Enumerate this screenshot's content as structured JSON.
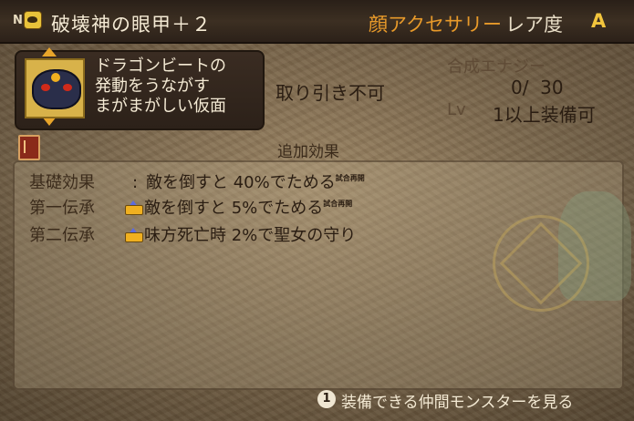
{
  "header": {
    "n_label": "N",
    "item_name": "破壊神の眼甲＋２",
    "category": "顔アクセサリー",
    "rarity_label": "レア度",
    "rarity_value": "A"
  },
  "description": {
    "lines": [
      "ドラゴンビートの",
      "発動をうながす",
      "まがまがしい仮面"
    ]
  },
  "info": {
    "trade": "取り引き不可",
    "synth_label": "合成エナジー",
    "synth_value": "0/  30",
    "lv_label": "Lv",
    "lv_value": "1以上装備可"
  },
  "effects": {
    "header": "追加効果",
    "rows": [
      {
        "label": "基礎効果",
        "separator": ":",
        "text": "敵を倒すと 40%でためる",
        "tag": "試合再開"
      },
      {
        "label": "第一伝承",
        "icon": "crown-icon",
        "text": "敵を倒すと 5%でためる",
        "tag": "試合再開"
      },
      {
        "label": "第二伝承",
        "icon": "crown-icon",
        "text": "味方死亡時 2%で聖女の守り"
      }
    ]
  },
  "footer": {
    "button": "1",
    "text": "装備できる仲間モンスターを見る"
  }
}
